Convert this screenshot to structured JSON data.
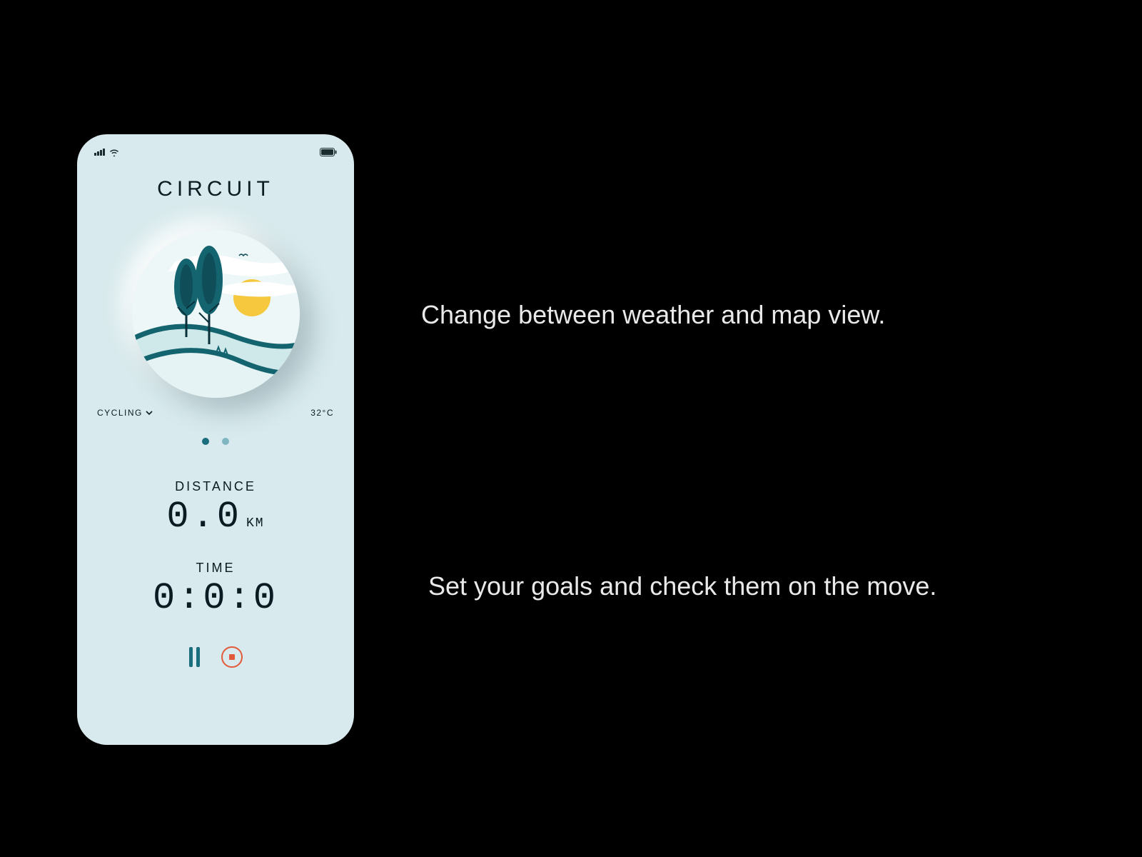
{
  "app": {
    "title": "CIRCUIT"
  },
  "activity": {
    "label": "CYCLING"
  },
  "temperature": "32°C",
  "distance": {
    "label": "DISTANCE",
    "value": "0.0",
    "unit": "KM"
  },
  "time": {
    "label": "TIME",
    "value": "0:0:0"
  },
  "captions": {
    "top": "Change between weather and map view.",
    "bottom": "Set your goals and check them on the move."
  },
  "icons": {
    "signal": "signal-icon",
    "wifi": "wifi-icon",
    "battery": "battery-icon",
    "chevron": "chevron-down-icon"
  }
}
